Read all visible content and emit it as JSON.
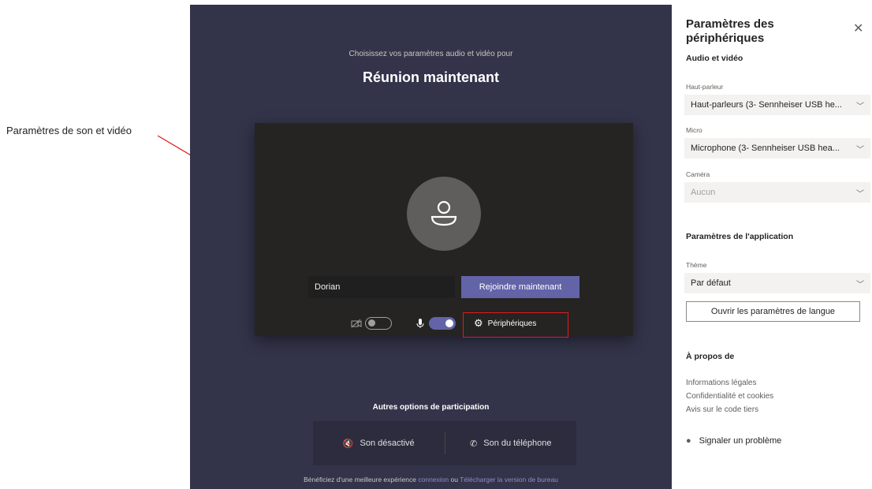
{
  "annotation": {
    "text": "Paramètres de son et vidéo"
  },
  "prejoin": {
    "subtitle": "Choisissez vos paramètres audio et vidéo pour",
    "meeting_title": "Réunion maintenant",
    "name_value": "Dorian",
    "join_label": "Rejoindre maintenant",
    "devices_label": "Périphériques",
    "other_options_label": "Autres options de participation",
    "audio_off_label": "Son désactivé",
    "phone_audio_label": "Son du téléphone",
    "footer": {
      "prefix": "Bénéficiez d'une meilleure expérience ",
      "link1": "connexion",
      "middle": " ou ",
      "link2": "Télécharger la version de bureau"
    },
    "camera_toggle": "off",
    "mic_toggle": "on"
  },
  "settings": {
    "title": "Paramètres des périphériques",
    "close_glyph": "✕",
    "audio_video_section": "Audio et vidéo",
    "speaker_label": "Haut-parleur",
    "speaker_value": "Haut-parleurs (3- Sennheiser USB he...",
    "mic_label": "Micro",
    "mic_value": "Microphone (3- Sennheiser USB hea...",
    "camera_label": "Caméra",
    "camera_value": "Aucun",
    "app_section": "Paramètres de l'application",
    "theme_label": "Thème",
    "theme_value": "Par défaut",
    "language_button": "Ouvrir les paramètres de langue",
    "about_section": "À propos de",
    "about_links": [
      "Informations légales",
      "Confidentialité et cookies",
      "Avis sur le code tiers"
    ],
    "report_label": "Signaler un problème"
  },
  "colors": {
    "accent": "#6264a7",
    "prejoin_bg": "#33344a",
    "card_bg": "#252423",
    "annotation_red": "#e01b1b"
  }
}
